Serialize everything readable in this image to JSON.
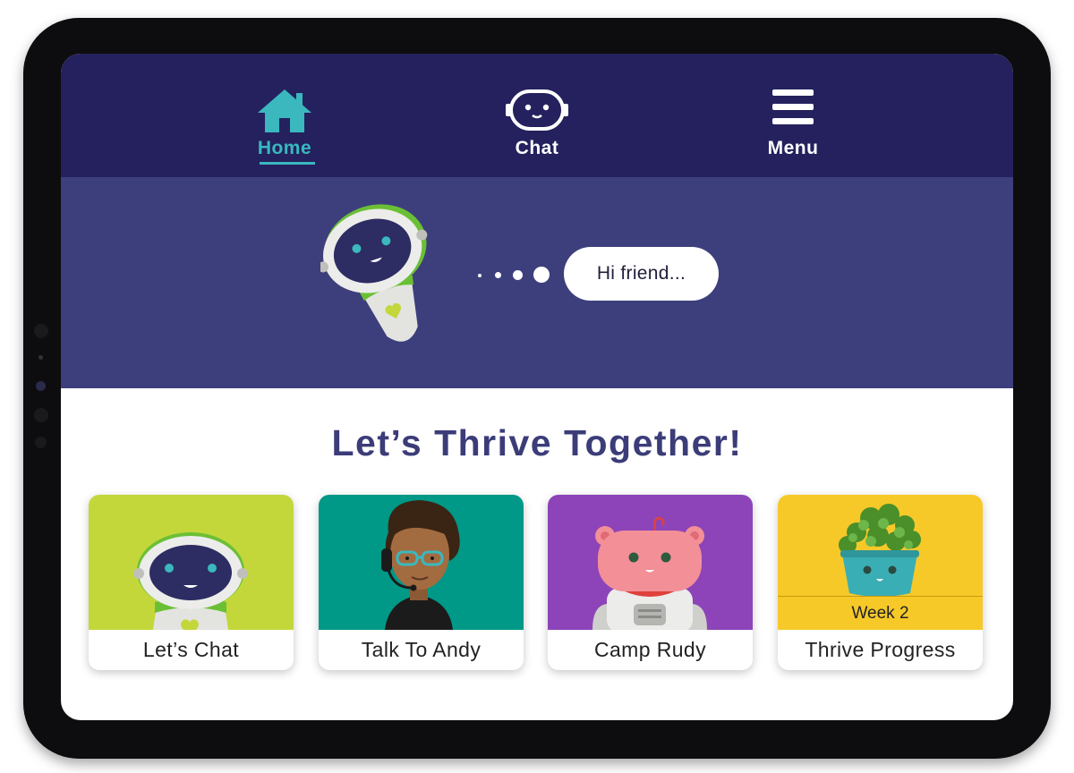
{
  "nav": {
    "items": [
      {
        "label": "Home",
        "icon": "house-icon",
        "active": true
      },
      {
        "label": "Chat",
        "icon": "robot-face-icon",
        "active": false
      },
      {
        "label": "Menu",
        "icon": "hamburger-menu-icon",
        "active": false
      }
    ],
    "active_color": "#3ab8be",
    "background": "#24215e"
  },
  "hero": {
    "greeting": "Hi friend...",
    "background": "#3d3f7c"
  },
  "main": {
    "heading": "Let’s Thrive Together!"
  },
  "cards": [
    {
      "label": "Let’s Chat",
      "color": "#c3d73b",
      "art": "robot-avatar"
    },
    {
      "label": "Talk To Andy",
      "color": "#009887",
      "art": "andy-avatar"
    },
    {
      "label": "Camp Rudy",
      "color": "#8d44b8",
      "art": "bear-robot-avatar"
    },
    {
      "label": "Thrive Progress",
      "color": "#f6c929",
      "art": "plant-pot-avatar",
      "badge": "Week 2"
    }
  ]
}
